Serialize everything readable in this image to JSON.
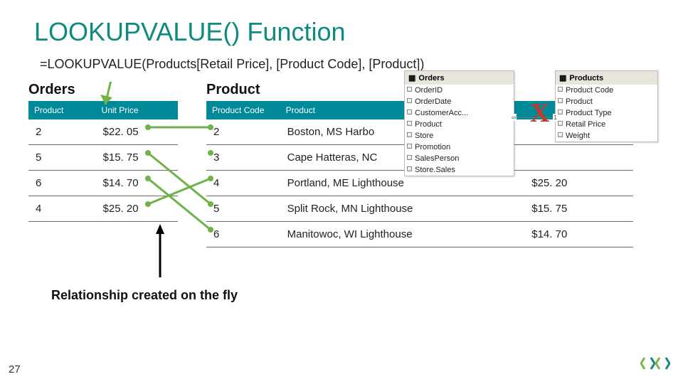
{
  "title": "LOOKUPVALUE() Function",
  "formula": "=LOOKUPVALUE(Products[Retail Price], [Product Code], [Product])",
  "tables": {
    "orders": {
      "name": "Orders",
      "headers": [
        "Product",
        "Unit Price"
      ],
      "rows": [
        [
          "2",
          "$22. 05"
        ],
        [
          "5",
          "$15. 75"
        ],
        [
          "6",
          "$14. 70"
        ],
        [
          "4",
          "$25. 20"
        ]
      ]
    },
    "product": {
      "name": "Product",
      "headers": [
        "Product Code",
        "Product",
        ""
      ],
      "rows": [
        [
          "2",
          "Boston, MS Harbo",
          ""
        ],
        [
          "3",
          "Cape Hatteras, NC",
          ""
        ],
        [
          "4",
          "Portland, ME Lighthouse",
          "$25. 20"
        ],
        [
          "5",
          "Split Rock, MN Lighthouse",
          "$15. 75"
        ],
        [
          "6",
          "Manitowoc, WI Lighthouse",
          "$14. 70"
        ]
      ]
    }
  },
  "field_panels": {
    "orders": {
      "title": "Orders",
      "fields": [
        "OrderID",
        "OrderDate",
        "CustomerAcc...",
        "Product",
        "Store",
        "Promotion",
        "SalesPerson",
        "Store.Sales"
      ]
    },
    "products": {
      "title": "Products",
      "fields": [
        "Product Code",
        "Product",
        "Product Type",
        "Retail Price",
        "Weight"
      ]
    },
    "link": {
      "left": "∞",
      "right": "1"
    }
  },
  "annotations": {
    "x": "X",
    "relationship": "Relationship created on the fly"
  },
  "page_number": "27"
}
